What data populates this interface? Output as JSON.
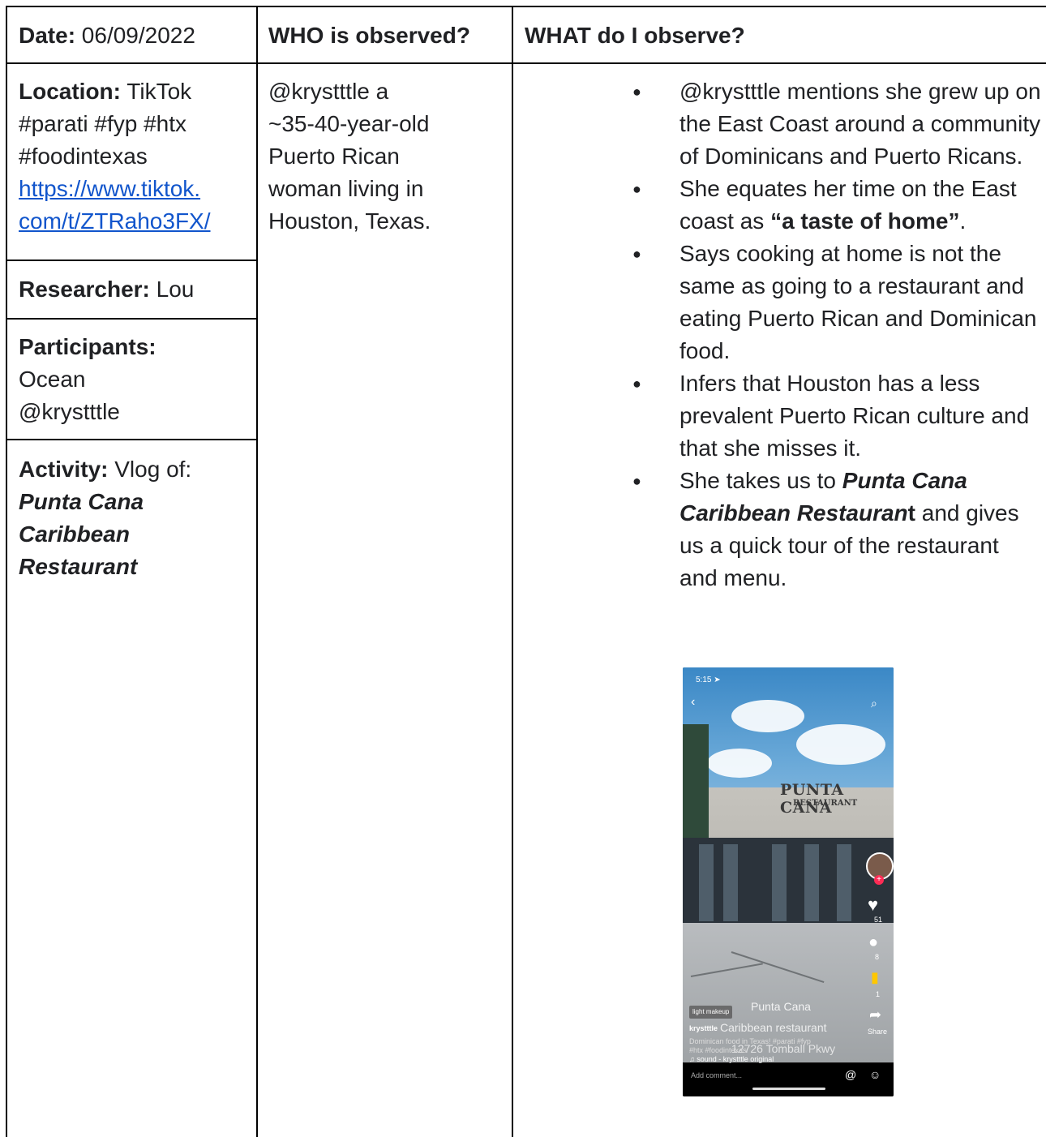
{
  "header": {
    "date_label": "Date:",
    "date_value": "06/09/2022",
    "who_header": "WHO is observed?",
    "what_header": "WHAT do I  observe?"
  },
  "left": {
    "location_label": "Location:",
    "location_value": "TikTok",
    "hashtags_1": "#parati #fyp #htx",
    "hashtags_2": "#foodintexas",
    "link_1": "https://www.tiktok.",
    "link_2": "com/t/ZTRaho3FX/",
    "researcher_label": "Researcher:",
    "researcher_value": "Lou",
    "participants_label": "Participants:",
    "participant_1": "Ocean",
    "participant_2": "@krystttle",
    "activity_label": "Activity:",
    "activity_value": "Vlog of:",
    "activity_place_1": "Punta Cana",
    "activity_place_2": "Caribbean",
    "activity_place_3": "Restaurant"
  },
  "who": {
    "line_1": "@krystttle a",
    "line_2": "~35-40-year-old",
    "line_3": "Puerto Rican",
    "line_4": "woman living in",
    "line_5": "Houston, Texas."
  },
  "what": {
    "b1": "@krystttle mentions she grew up on the East Coast around a community of Dominicans and Puerto Ricans.",
    "b2_pre": "She equates her time on the East coast as ",
    "b2_q_open": "“",
    "b2_bold": "a taste of home",
    "b2_q_close": "”",
    "b2_post": ".",
    "b3": "Says cooking at home is not the same as going to a restaurant and eating Puerto Rican and Dominican food.",
    "b4": "Infers that Houston has a less prevalent Puerto Rican culture and that she misses it.",
    "b5_pre": " She takes us to ",
    "b5_bold_italic": "Punta Cana Caribbean Restauran",
    "b5_bold_t": "t",
    "b5_post": " and gives us a quick tour of the restaurant and menu."
  },
  "phone": {
    "time": "5:15",
    "sign_main": "PUNTA CANA",
    "sign_sub": "RESTAURANT",
    "overlay_1": "Punta Cana",
    "overlay_2": "Caribbean restaurant",
    "overlay_3": "12726 Tomball Pkwy",
    "chip": "light makeup",
    "username": "krystttle",
    "desc_1": "Dominican food in Texas! #parati #fyp",
    "desc_2": "#htx #foodintexas",
    "sound": "sound - krystttle   original",
    "likes": "51",
    "comments": "8",
    "saves": "1",
    "share": "Share",
    "add_comment": "Add comment..."
  }
}
